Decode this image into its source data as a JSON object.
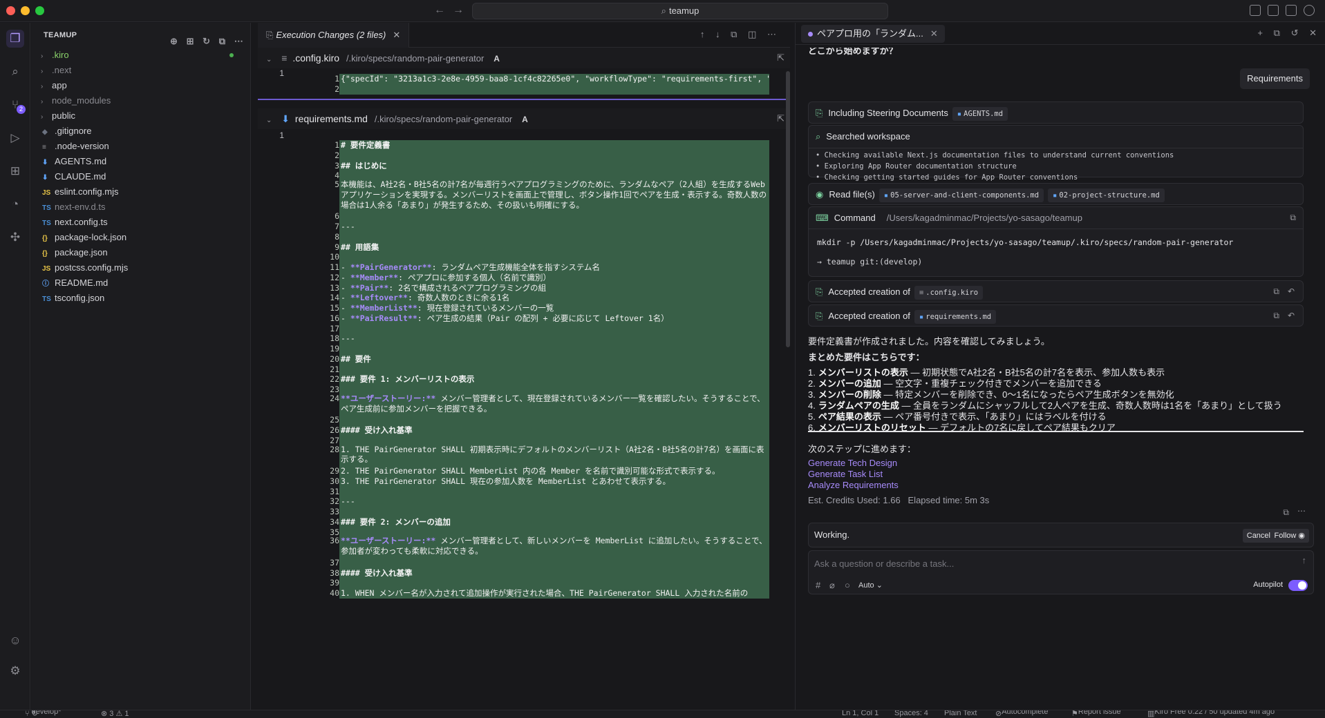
{
  "window": {
    "search_text": "teamup"
  },
  "activity_bar": {
    "scm_badge": "2"
  },
  "explorer": {
    "title": "TEAMUP",
    "items": [
      {
        "name": ".kiro",
        "type": "folder",
        "icon": "›"
      },
      {
        "name": ".next",
        "type": "folder",
        "icon": "›"
      },
      {
        "name": "app",
        "type": "folder",
        "icon": "›"
      },
      {
        "name": "node_modules",
        "type": "folder",
        "icon": "›"
      },
      {
        "name": "public",
        "type": "folder",
        "icon": "›"
      },
      {
        "name": ".gitignore",
        "type": "file",
        "icon": "◆"
      },
      {
        "name": ".node-version",
        "type": "file",
        "icon": "≡"
      },
      {
        "name": "AGENTS.md",
        "type": "file",
        "icon": "⬇"
      },
      {
        "name": "CLAUDE.md",
        "type": "file",
        "icon": "⬇"
      },
      {
        "name": "eslint.config.mjs",
        "type": "file",
        "icon": "JS"
      },
      {
        "name": "next-env.d.ts",
        "type": "file",
        "icon": "TS"
      },
      {
        "name": "next.config.ts",
        "type": "file",
        "icon": "TS"
      },
      {
        "name": "package-lock.json",
        "type": "file",
        "icon": "{}"
      },
      {
        "name": "package.json",
        "type": "file",
        "icon": "{}"
      },
      {
        "name": "postcss.config.mjs",
        "type": "file",
        "icon": "JS"
      },
      {
        "name": "README.md",
        "type": "file",
        "icon": "ⓘ"
      },
      {
        "name": "tsconfig.json",
        "type": "file",
        "icon": "TS"
      }
    ]
  },
  "editor": {
    "tab_label": "Execution Changes (2 files)",
    "files": [
      {
        "name": ".config.kiro",
        "path": "/.kiro/specs/random-pair-generator",
        "status": "A",
        "old_line": "1",
        "lines": [
          {
            "n": "1",
            "text": "{\"specId\": \"3213a1c3-2e8e-4959-baa8-1cf4c82265e0\", \"workflowType\": \"requirements-first\", \"s"
          },
          {
            "n": "2",
            "text": ""
          }
        ]
      },
      {
        "name": "requirements.md",
        "path": "/.kiro/specs/random-pair-generator",
        "status": "A",
        "old_line": "1",
        "lines": [
          {
            "n": "1",
            "text": "# 要件定義書"
          },
          {
            "n": "2",
            "text": ""
          },
          {
            "n": "3",
            "text": "## はじめに"
          },
          {
            "n": "4",
            "text": ""
          },
          {
            "n": "5",
            "text": "本機能は、A社2名・B社5名の計7名が毎週行うペアプログラミングのために、ランダムなペア（2人組）を生成するWebアプリケーションを実現する。メンバーリストを画面上で管理し、ボタン操作1回でペアを生成・表示する。奇数人数の場合は1人余る「あまり」が発生するため、その扱いも明確にする。"
          },
          {
            "n": "6",
            "text": ""
          },
          {
            "n": "7",
            "text": "---"
          },
          {
            "n": "8",
            "text": ""
          },
          {
            "n": "9",
            "text": "## 用語集"
          },
          {
            "n": "10",
            "text": ""
          },
          {
            "n": "11",
            "text": "- **PairGenerator**: ランダムペア生成機能全体を指すシステム名"
          },
          {
            "n": "12",
            "text": "- **Member**: ペアプロに参加する個人（名前で識別）"
          },
          {
            "n": "13",
            "text": "- **Pair**: 2名で構成されるペアプログラミングの組"
          },
          {
            "n": "14",
            "text": "- **Leftover**: 奇数人数のときに余る1名"
          },
          {
            "n": "15",
            "text": "- **MemberList**: 現在登録されているメンバーの一覧"
          },
          {
            "n": "16",
            "text": "- **PairResult**: ペア生成の結果（Pair の配列 + 必要に応じて Leftover 1名）"
          },
          {
            "n": "17",
            "text": ""
          },
          {
            "n": "18",
            "text": "---"
          },
          {
            "n": "19",
            "text": ""
          },
          {
            "n": "20",
            "text": "## 要件"
          },
          {
            "n": "21",
            "text": ""
          },
          {
            "n": "22",
            "text": "### 要件 1: メンバーリストの表示"
          },
          {
            "n": "23",
            "text": ""
          },
          {
            "n": "24",
            "text": "**ユーザーストーリー:** メンバー管理者として、現在登録されているメンバー一覧を確認したい。そうすることで、ペア生成前に参加メンバーを把握できる。"
          },
          {
            "n": "25",
            "text": ""
          },
          {
            "n": "26",
            "text": "#### 受け入れ基準"
          },
          {
            "n": "27",
            "text": ""
          },
          {
            "n": "28",
            "text": "1. THE PairGenerator SHALL 初期表示時にデフォルトのメンバーリスト（A社2名・B社5名の計7名）を画面に表示する。"
          },
          {
            "n": "29",
            "text": "2. THE PairGenerator SHALL MemberList 内の各 Member を名前で識別可能な形式で表示する。"
          },
          {
            "n": "30",
            "text": "3. THE PairGenerator SHALL 現在の参加人数を MemberList とあわせて表示する。"
          },
          {
            "n": "31",
            "text": ""
          },
          {
            "n": "32",
            "text": "---"
          },
          {
            "n": "33",
            "text": ""
          },
          {
            "n": "34",
            "text": "### 要件 2: メンバーの追加"
          },
          {
            "n": "35",
            "text": ""
          },
          {
            "n": "36",
            "text": "**ユーザーストーリー:** メンバー管理者として、新しいメンバーを MemberList に追加したい。そうすることで、参加者が変わっても柔軟に対応できる。"
          },
          {
            "n": "37",
            "text": ""
          },
          {
            "n": "38",
            "text": "#### 受け入れ基準"
          },
          {
            "n": "39",
            "text": ""
          },
          {
            "n": "40",
            "text": "1. WHEN メンバー名が入力されて追加操作が実行された場合、THE PairGenerator SHALL 入力された名前の"
          }
        ]
      }
    ]
  },
  "chat": {
    "tab_label": "ペアプロ用の「ランダム...",
    "top_text": "どこから始めますか？",
    "requirements_pill": "Requirements",
    "steering": {
      "label": "Including Steering Documents",
      "chip": "AGENTS.md"
    },
    "searched": {
      "label": "Searched workspace",
      "bullets": [
        "Checking available Next.js documentation files to understand current conventions",
        "Exploring App Router documentation structure",
        "Checking getting started guides for App Router conventions"
      ]
    },
    "read_files": {
      "label": "Read file(s)",
      "chips": [
        "05-server-and-client-components.md",
        "02-project-structure.md"
      ]
    },
    "command": {
      "label": "Command",
      "cwd": "/Users/kagadminmac/Projects/yo-sasago/teamup",
      "cmd": "mkdir -p /Users/kagadminmac/Projects/yo-sasago/teamup/.kiro/specs/random-pair-generator",
      "prompt": "→  teamup git:(develop)"
    },
    "accepted": [
      {
        "label": "Accepted creation of",
        "chip": ".config.kiro"
      },
      {
        "label": "Accepted creation of",
        "chip": "requirements.md"
      }
    ],
    "message_intro": "要件定義書が作成されました。内容を確認してみましょう。",
    "summary_heading": "まとめた要件はこちらです：",
    "requirements": [
      {
        "num": "1.",
        "title": "メンバーリストの表示",
        "desc": " — 初期状態でA社2名・B社5名の計7名を表示、参加人数も表示"
      },
      {
        "num": "2.",
        "title": "メンバーの追加",
        "desc": " — 空文字・重複チェック付きでメンバーを追加できる"
      },
      {
        "num": "3.",
        "title": "メンバーの削除",
        "desc": " — 特定メンバーを削除でき、0〜1名になったらペア生成ボタンを無効化"
      },
      {
        "num": "4.",
        "title": "ランダムペアの生成",
        "desc": " — 全員をランダムにシャッフルして2人ペアを生成、奇数人数時は1名を「あまり」として扱う"
      },
      {
        "num": "5.",
        "title": "ペア結果の表示",
        "desc": " — ペア番号付きで表示、「あまり」にはラベルを付ける"
      },
      {
        "num": "6.",
        "title": "メンバーリストのリセット",
        "desc": " — デフォルトの7名に戻してペア結果もクリア"
      }
    ],
    "next_steps_label": "次のステップに進めます：",
    "next_links": [
      "Generate Tech Design",
      "Generate Task List",
      "Analyze Requirements"
    ],
    "credits": "Est. Credits Used: 1.66   Elapsed time: 5m 3s",
    "working_text": "Working.",
    "cancel_label": "Cancel",
    "follow_label": "Follow",
    "input_placeholder": "Ask a question or describe a task...",
    "mode_label": "Auto",
    "autopilot_label": "Autopilot"
  },
  "statusbar": {
    "branch": "develop*",
    "problems": "⊗ 3 ⚠ 1",
    "position": "Ln 1, Col 1",
    "spaces": "Spaces: 4",
    "language": "Plain Text",
    "autocomplete": "Autocomplete",
    "report": "Report issue",
    "plan": "Kiro Free 0.22 / 50 updated 4m ago"
  },
  "colors": {
    "accent": "#a78bfa",
    "added": "#385f47",
    "kiro_folder": "#8bd36b"
  }
}
